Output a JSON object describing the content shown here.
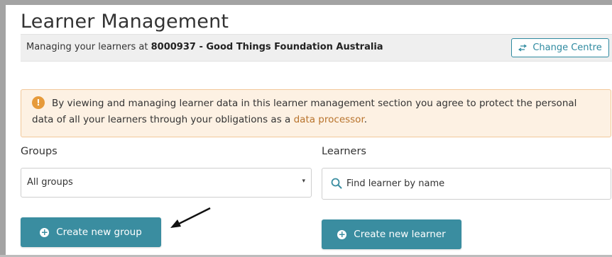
{
  "page": {
    "title": "Learner Management"
  },
  "centre": {
    "prefix": "Managing your learners at",
    "centre_name": "8000937 - Good Things Foundation Australia",
    "change_button_label": "Change Centre"
  },
  "notice": {
    "icon": "info-icon",
    "text": "By viewing and managing learner data in this learner management section you agree to protect the personal data of all your learners through your obligations as a",
    "link_text": "data processor",
    "suffix": "."
  },
  "groups": {
    "label": "Groups",
    "selected": "All groups",
    "create_button_label": "Create new group"
  },
  "learners": {
    "label": "Learners",
    "search_placeholder": "Find learner by name",
    "create_button_label": "Create new learner"
  },
  "colors": {
    "accent": "#3a8da0",
    "notice_bg": "#fdf1e3",
    "notice_border": "#f2c89a",
    "notice_icon": "#e69a3a",
    "link": "#b8732c"
  }
}
